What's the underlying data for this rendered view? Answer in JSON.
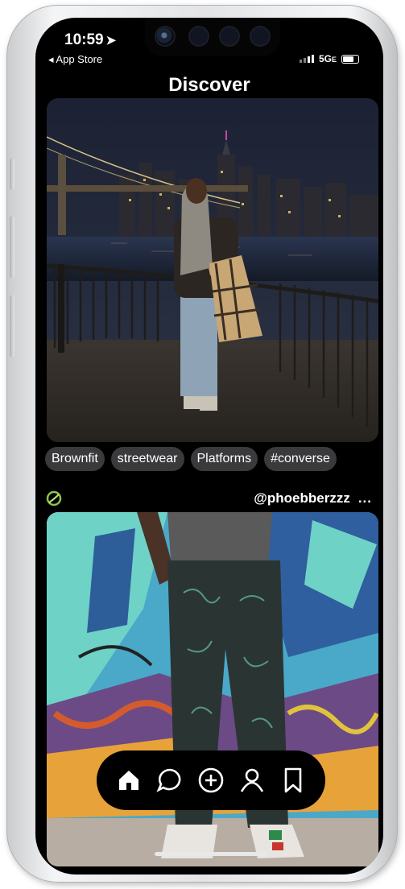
{
  "status_bar": {
    "time": "10:59",
    "back_label": "◂ App Store",
    "network": "5G",
    "network_suffix": "E"
  },
  "header": {
    "title": "Discover"
  },
  "post1": {
    "image_alt": "Person standing by a waterfront railing at night with a lit city skyline and bridge behind",
    "tags": [
      "Brownfit",
      "streetwear",
      "Platforms",
      "#converse"
    ]
  },
  "post2": {
    "username": "@phoebberzzz",
    "more_label": "...",
    "image_alt": "Legs in patterned cargo pants in front of a graffiti wall"
  },
  "tab_bar": {
    "items": [
      "home-icon",
      "chat-icon",
      "add-icon",
      "profile-icon",
      "bookmark-icon"
    ]
  },
  "colors": {
    "background": "#000000",
    "tag_background": "#3a3a3c",
    "text": "#ffffff"
  }
}
